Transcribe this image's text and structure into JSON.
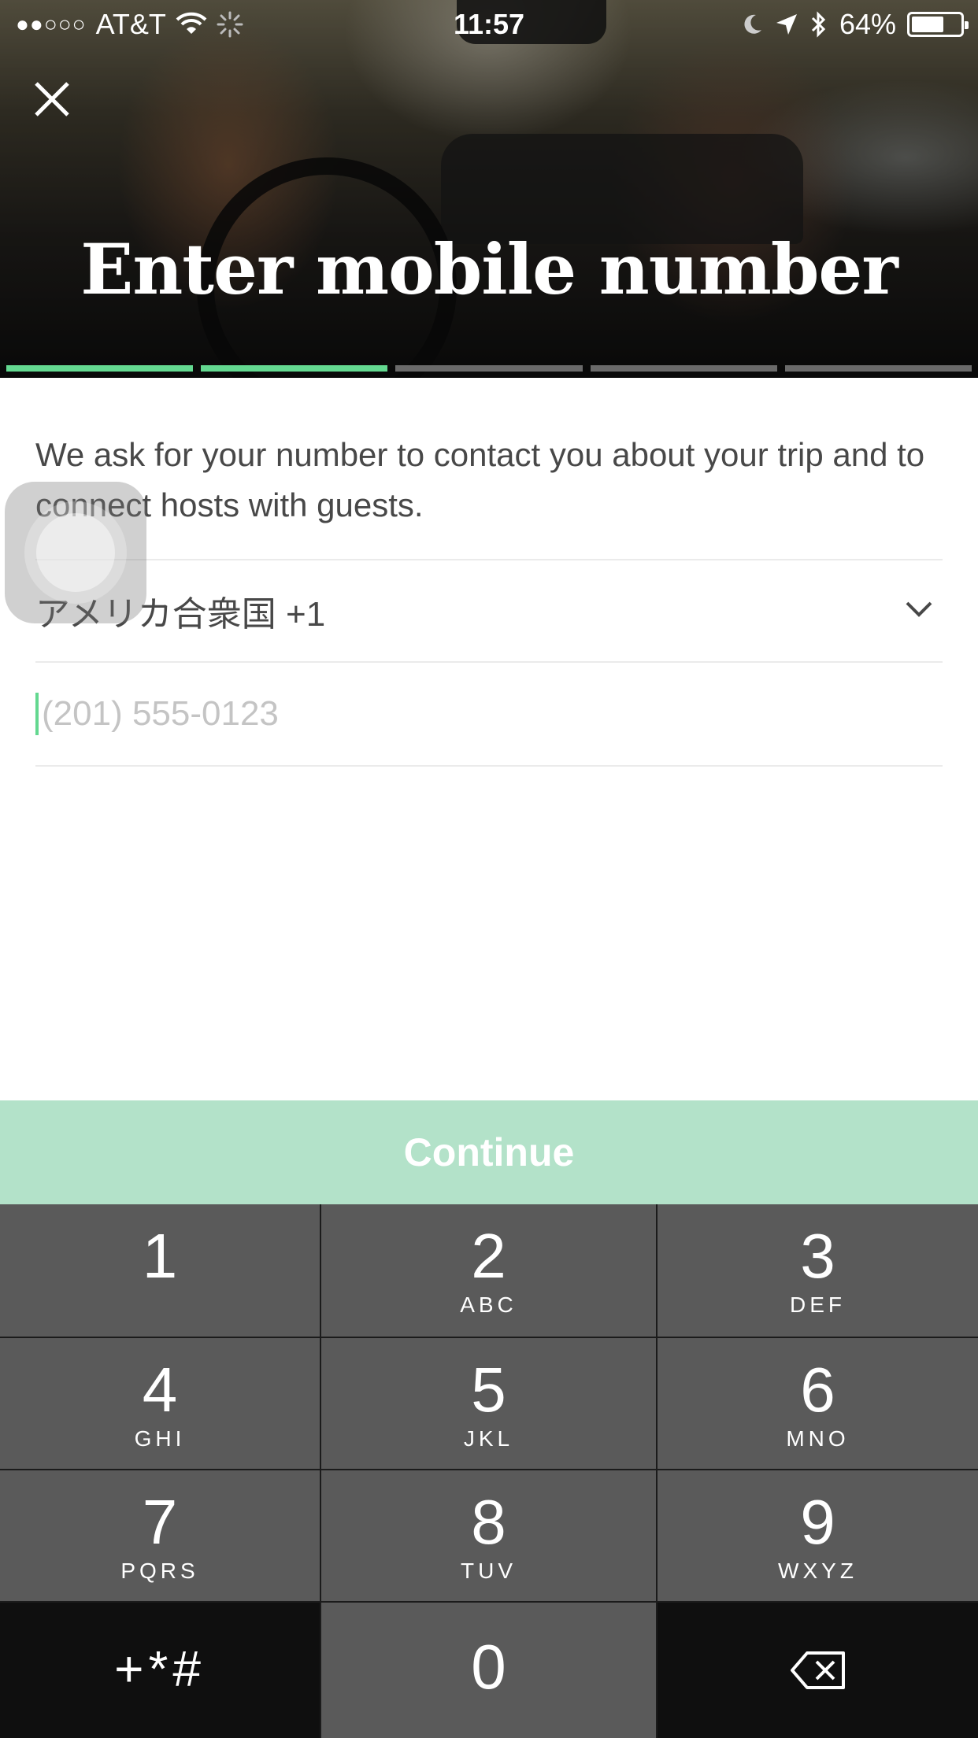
{
  "status_bar": {
    "signal": "●●○○○",
    "carrier": "AT&T",
    "time": "11:57",
    "battery_percent": "64%",
    "battery_level": 0.64
  },
  "header": {
    "title": "Enter mobile number",
    "progress_total_steps": 5,
    "progress_completed_steps": 2
  },
  "form": {
    "intro_text": "We ask for your number to contact you about your trip and to connect hosts with guests.",
    "country_selector": "アメリカ合衆国 +1",
    "phone_placeholder": "(201) 555-0123",
    "phone_value": ""
  },
  "continue_label": "Continue",
  "keypad": {
    "keys": [
      {
        "num": "1",
        "letters": ""
      },
      {
        "num": "2",
        "letters": "ABC"
      },
      {
        "num": "3",
        "letters": "DEF"
      },
      {
        "num": "4",
        "letters": "GHI"
      },
      {
        "num": "5",
        "letters": "JKL"
      },
      {
        "num": "6",
        "letters": "MNO"
      },
      {
        "num": "7",
        "letters": "PQRS"
      },
      {
        "num": "8",
        "letters": "TUV"
      },
      {
        "num": "9",
        "letters": "WXYZ"
      }
    ],
    "symbols": "+*#",
    "zero": "0"
  },
  "colors": {
    "accent_green": "#63d890",
    "continue_disabled": "#b3e2c9",
    "key_gray": "#5a5a5a",
    "key_dark": "#0f0f0f"
  }
}
